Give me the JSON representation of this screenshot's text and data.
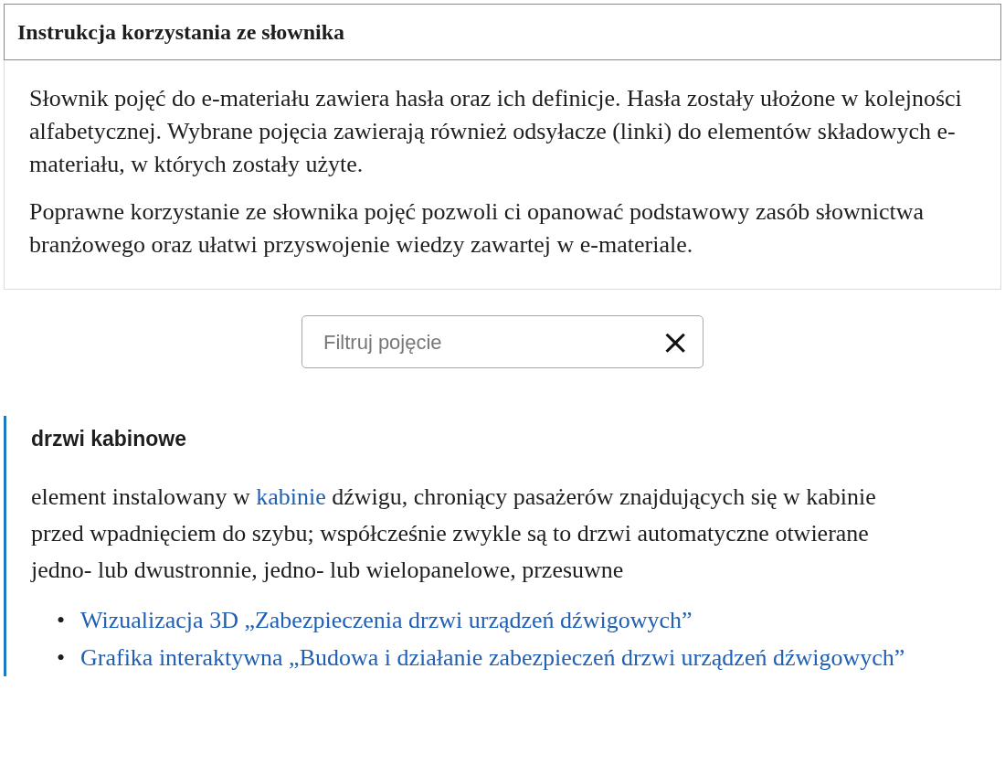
{
  "instructions": {
    "title": "Instrukcja korzystania ze słownika",
    "paragraphs": [
      "Słownik pojęć do e-materiału zawiera hasła oraz ich definicje. Hasła zostały ułożone w kolejności alfabetycznej. Wybrane pojęcia zawierają również odsyłacze (linki) do elementów składowych e-materiału, w których zostały użyte.",
      "Poprawne korzystanie ze słownika pojęć pozwoli ci opanować podstawowy zasób słownictwa branżowego oraz ułatwi przyswojenie wiedzy zawartej w e-materiale."
    ]
  },
  "filter": {
    "placeholder": "Filtruj pojęcie",
    "clear": "×"
  },
  "entries": [
    {
      "term": "drzwi kabinowe",
      "definition": [
        {
          "kind": "text",
          "text": "element instalowany w "
        },
        {
          "kind": "link",
          "text": "kabinie"
        },
        {
          "kind": "text",
          "text": " dźwigu, chroniący pasażerów znajdujących się w kabinie przed wpadnięciem do szybu; współcześnie zwykle są to drzwi automatyczne otwierane jedno- lub dwustronnie, jedno- lub wielopanelowe, przesuwne"
        }
      ],
      "links": [
        {
          "bullet": "•",
          "text": "Wizualizacja 3D „Zabezpieczenia drzwi urządzeń dźwigowych”"
        },
        {
          "bullet": "•",
          "text": "Grafika interaktywna „Budowa i działanie zabezpieczeń drzwi urządzeń dźwigowych”"
        }
      ]
    }
  ]
}
